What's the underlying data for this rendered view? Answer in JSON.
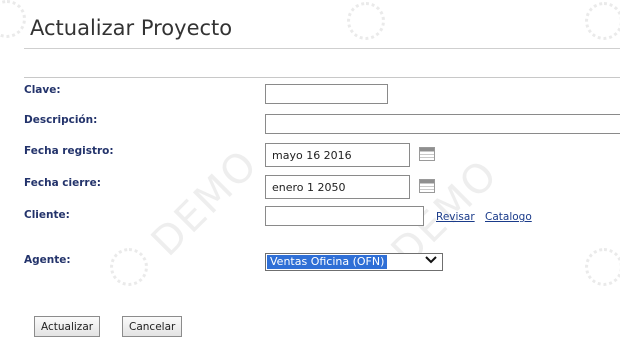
{
  "page": {
    "title": "Actualizar Proyecto"
  },
  "form": {
    "clave": {
      "label": "Clave:",
      "value": ""
    },
    "descripcion": {
      "label": "Descripción:",
      "value": ""
    },
    "fecha_registro": {
      "label": "Fecha registro:",
      "value": "mayo 16 2016",
      "icon": "calendar-icon"
    },
    "fecha_cierre": {
      "label": "Fecha cierre:",
      "value": "enero 1 2050",
      "icon": "calendar-icon"
    },
    "cliente": {
      "label": "Cliente:",
      "value": "",
      "revisar_label": "Revisar",
      "catalogo_label": "Catalogo"
    },
    "agente": {
      "label": "Agente:",
      "selected": "Ventas Oficina (OFN)",
      "icon": "chevron-down-icon"
    }
  },
  "buttons": {
    "actualizar": "Actualizar",
    "cancelar": "Cancelar"
  },
  "watermark": {
    "text": "DEMO"
  },
  "colors": {
    "label": "#23336b",
    "link": "#1a3b8a",
    "selection": "#2f6fd6"
  }
}
